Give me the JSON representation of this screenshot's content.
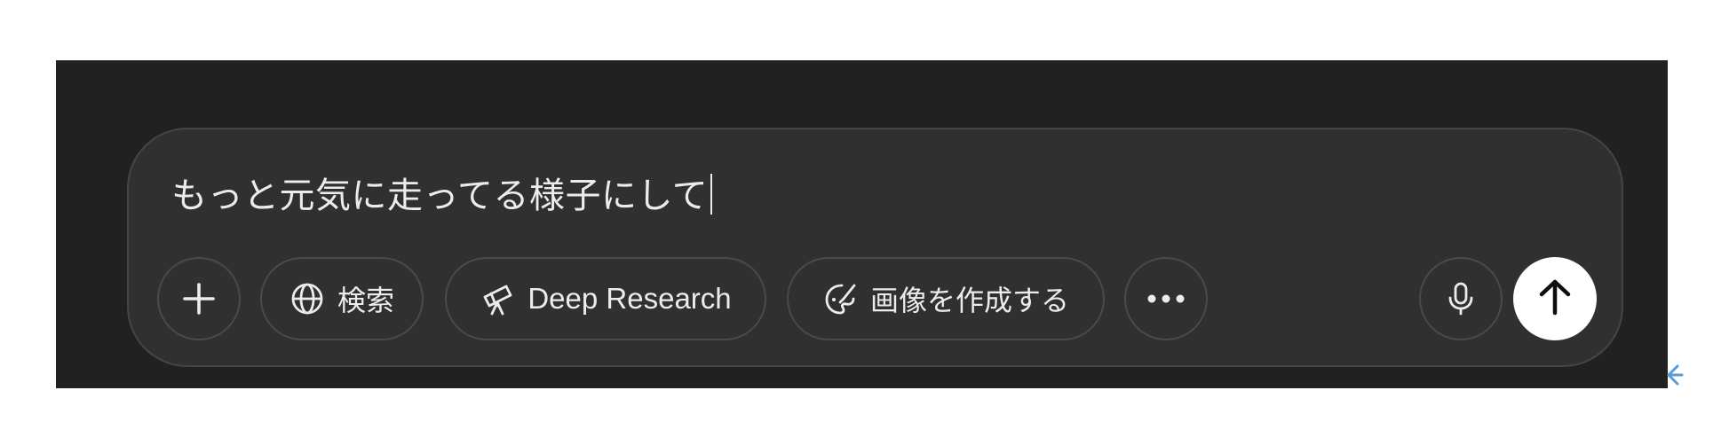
{
  "composer": {
    "input_value": "もっと元気に走ってる様子にして"
  },
  "toolbar": {
    "add": {
      "icon": "plus-icon"
    },
    "search": {
      "icon": "globe-icon",
      "label": "検索"
    },
    "deep_research": {
      "icon": "telescope-icon",
      "label": "Deep Research"
    },
    "create_image": {
      "icon": "palette-icon",
      "label": "画像を作成する"
    },
    "more": {
      "icon": "ellipsis-icon"
    },
    "voice": {
      "icon": "microphone-icon"
    },
    "send": {
      "icon": "arrow-up-icon"
    }
  },
  "edge_toggle": {
    "icon": "chevron-left-icon"
  },
  "colors": {
    "background": "#212121",
    "composer": "#303030",
    "border": "#454545",
    "text": "#ececec",
    "send_button": "#ffffff",
    "edge_toggle": "#5b9bd5"
  }
}
